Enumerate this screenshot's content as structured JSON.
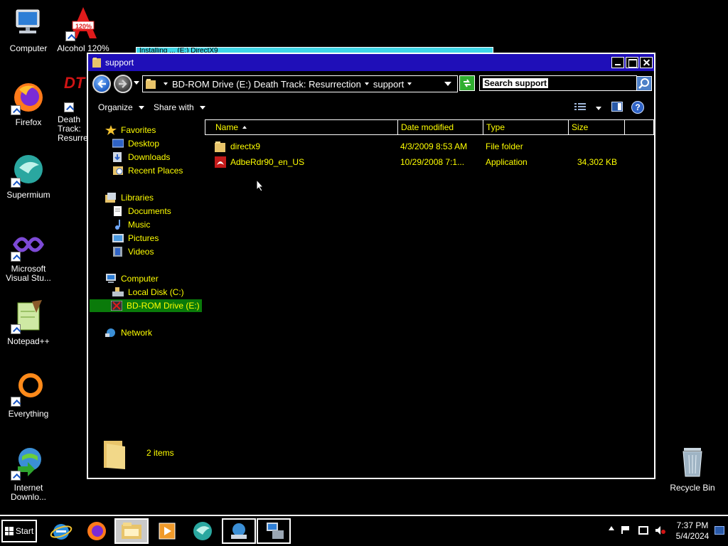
{
  "desktop": {
    "icons": [
      {
        "label": "Computer"
      },
      {
        "label": "Alcohol 120%"
      },
      {
        "label": "Firefox"
      },
      {
        "label": "Death Track: Resurrection"
      },
      {
        "label": "Supermium"
      },
      {
        "label": "Microsoft Visual Stu..."
      },
      {
        "label": "Notepad++"
      },
      {
        "label": "Everything"
      },
      {
        "label": "Internet Downlo..."
      },
      {
        "label": "Recycle Bin"
      }
    ],
    "alcohol_badge": "120%",
    "death_track_badge": "DT"
  },
  "background_window": {
    "title": "Installing ... (E:) DirectX9"
  },
  "window": {
    "title": "support",
    "address": {
      "crumbs": [
        "BD-ROM Drive (E:) Death Track: Resurrection",
        "support"
      ]
    },
    "search": {
      "placeholder": "Search support"
    },
    "toolbar": {
      "organize": "Organize",
      "share_with": "Share with",
      "help": "?"
    },
    "nav": {
      "favorites_header": "Favorites",
      "favorites": [
        "Desktop",
        "Downloads",
        "Recent Places"
      ],
      "libraries_header": "Libraries",
      "libraries": [
        "Documents",
        "Music",
        "Pictures",
        "Videos"
      ],
      "computer_header": "Computer",
      "computer": [
        "Local Disk (C:)",
        "BD-ROM Drive (E:)"
      ],
      "network": "Network"
    },
    "columns": {
      "name": "Name",
      "date_modified": "Date modified",
      "type": "Type",
      "size": "Size"
    },
    "files": [
      {
        "name": "directx9",
        "date": "4/3/2009 8:53 AM",
        "type": "File folder",
        "size": ""
      },
      {
        "name": "AdbeRdr90_en_US",
        "date": "10/29/2008 7:1...",
        "type": "Application",
        "size": "34,302 KB"
      }
    ],
    "details": {
      "item_count": "2 items"
    }
  },
  "taskbar": {
    "start_label": "Start",
    "clock_time": "7:37 PM",
    "clock_date": "5/4/2024"
  },
  "colors": {
    "window_title_bg": "#1f0fb8",
    "text_yellow": "#ffff00",
    "selected_green": "#0a7a0a"
  }
}
